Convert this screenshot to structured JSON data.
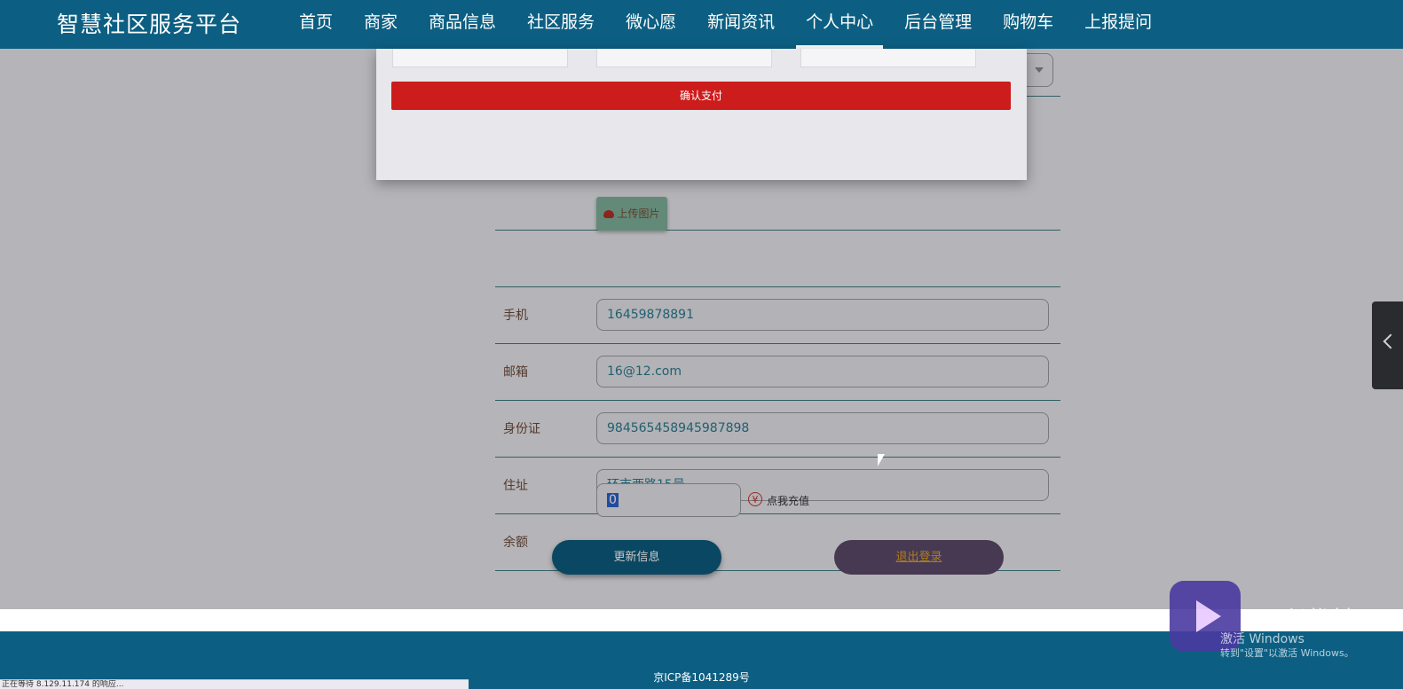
{
  "header": {
    "brand": "智慧社区服务平台",
    "nav": [
      {
        "label": "首页"
      },
      {
        "label": "商家"
      },
      {
        "label": "商品信息"
      },
      {
        "label": "社区服务"
      },
      {
        "label": "微心愿"
      },
      {
        "label": "新闻资讯"
      },
      {
        "label": "个人中心",
        "active": true
      },
      {
        "label": "后台管理"
      },
      {
        "label": "购物车"
      },
      {
        "label": "上报提问"
      }
    ]
  },
  "modal": {
    "pay_button": "确认支付"
  },
  "form": {
    "upload_button": "上传图片",
    "fields": {
      "phone": {
        "label": "手机",
        "value": "16459878891"
      },
      "email": {
        "label": "邮箱",
        "value": "16@12.com"
      },
      "id_card": {
        "label": "身份证",
        "value": "984565458945987898"
      },
      "address": {
        "label": "住址",
        "value": "环市西路15号"
      },
      "balance": {
        "label": "余额",
        "value": "0"
      }
    },
    "recharge_link": "点我充值",
    "yen_icon": "yen-icon",
    "update_button": "更新信息",
    "logout_button": "退出登录"
  },
  "footer": {
    "icp": "京ICP备1041289号"
  },
  "status_bar": {
    "text": "正在等待 8.129.11.174 的响应..."
  },
  "watermark": {
    "brand": "万兴优转",
    "activate_title": "激活 Windows",
    "activate_sub": "转到\"设置\"以激活 Windows。"
  },
  "colors": {
    "header_bg": "#0c5f82",
    "pay_button_bg": "#cc1c1c",
    "update_button_bg": "#0e5c7e",
    "logout_button_bg": "#5b4a6a"
  }
}
